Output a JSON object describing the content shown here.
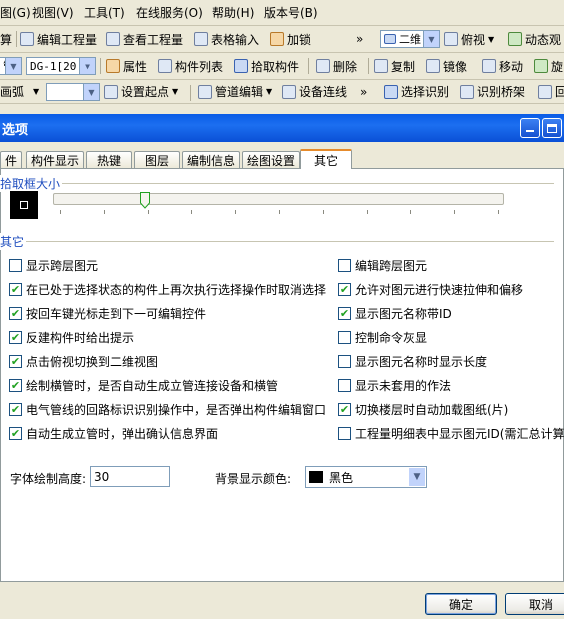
{
  "menubar": {
    "items": [
      "图(G)",
      "视图(V)",
      "工具(T)",
      "在线服务(O)",
      "帮助(H)",
      "版本号(B)"
    ]
  },
  "toolbar1": {
    "calc": "算",
    "edit_project": "编辑工程量",
    "view_project": "查看工程量",
    "table_input": "表格输入",
    "lock": "加锁",
    "more": "»",
    "view_mode": "二维",
    "view_dir": "俯视",
    "dynamic_view": "动态观"
  },
  "toolbar2": {
    "layer": "管",
    "component": "DG-1[20 ]",
    "properties": "属性",
    "component_list": "构件列表",
    "pick_component": "拾取构件",
    "delete": "删除",
    "copy": "复制",
    "mirror": "镜像",
    "move": "移动",
    "rotate": "旋"
  },
  "toolbar3": {
    "arc": "画弧",
    "set_origin": "设置起点",
    "pipe_edit": "管道编辑",
    "device_connect": "设备连线",
    "more": "»",
    "select_recognize": "选择识别",
    "recognize_bridge": "识别桥架",
    "last": "回"
  },
  "dialog": {
    "title": "选项",
    "tabs": [
      "件",
      "构件显示",
      "热键",
      "图层",
      "编制信息",
      "绘图设置",
      "其它"
    ],
    "active_tab": "其它",
    "pick_box_label": "拾取框大小",
    "other_label": "其它",
    "slider_level": 0.21,
    "checkboxes_left": [
      {
        "label": "显示跨层图元",
        "checked": false
      },
      {
        "label": "在已处于选择状态的构件上再次执行选择操作时取消选择",
        "checked": true
      },
      {
        "label": "按回车键光标走到下一可编辑控件",
        "checked": true
      },
      {
        "label": "反建构件时给出提示",
        "checked": true
      },
      {
        "label": "点击俯视切换到二维视图",
        "checked": true
      },
      {
        "label": "绘制横管时，是否自动生成立管连接设备和横管",
        "checked": true
      },
      {
        "label": "电气管线的回路标识识别操作中，是否弹出构件编辑窗口",
        "checked": true
      },
      {
        "label": "自动生成立管时，弹出确认信息界面",
        "checked": true
      }
    ],
    "checkboxes_right": [
      {
        "label": "编辑跨层图元",
        "checked": false
      },
      {
        "label": "允许对图元进行快速拉伸和偏移",
        "checked": true
      },
      {
        "label": "显示图元名称带ID",
        "checked": true
      },
      {
        "label": "控制命令灰显",
        "checked": false
      },
      {
        "label": "显示图元名称时显示长度",
        "checked": false
      },
      {
        "label": "显示未套用的作法",
        "checked": false
      },
      {
        "label": "切换楼层时自动加载图纸(片)",
        "checked": true
      },
      {
        "label": "工程量明细表中显示图元ID(需汇总计算)",
        "checked": false
      }
    ],
    "font_height_label": "字体绘制高度:",
    "font_height_value": "30",
    "bg_color_label": "背景显示颜色:",
    "bg_color_value": "黑色",
    "bg_color_swatch": "#000000",
    "ok": "确定",
    "cancel": "取消"
  }
}
